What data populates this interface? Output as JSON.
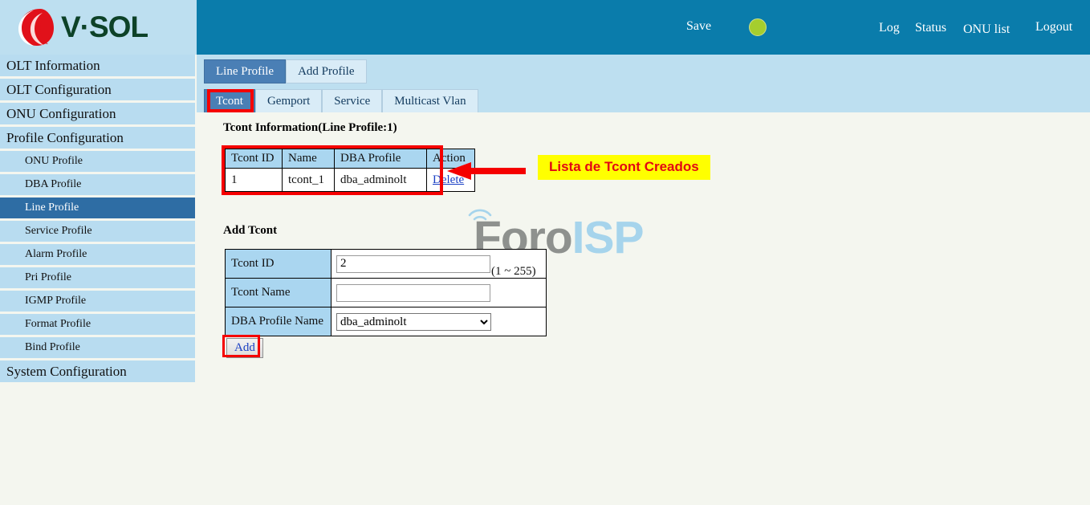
{
  "brand": {
    "name": "V·SOL",
    "logo_icon": "vsol-swirl-icon",
    "logo_color": "#e1111a",
    "text_color": "#0d4228"
  },
  "header": {
    "background": "#0a7cab",
    "save_label": "Save",
    "status_indicator": {
      "icon": "green-status-dot-icon",
      "color": "#a5ce2e"
    },
    "links": [
      {
        "label": "Log"
      },
      {
        "label": "Status"
      },
      {
        "label": "ONU list"
      },
      {
        "label": "Logout"
      }
    ]
  },
  "sidebar": {
    "items": [
      {
        "label": "OLT Information",
        "sub": false,
        "active": false
      },
      {
        "label": "OLT Configuration",
        "sub": false,
        "active": false
      },
      {
        "label": "ONU Configuration",
        "sub": false,
        "active": false
      },
      {
        "label": "Profile Configuration",
        "sub": false,
        "active": false
      },
      {
        "label": "ONU Profile",
        "sub": true,
        "active": false
      },
      {
        "label": "DBA Profile",
        "sub": true,
        "active": false
      },
      {
        "label": "Line Profile",
        "sub": true,
        "active": true
      },
      {
        "label": "Service Profile",
        "sub": true,
        "active": false
      },
      {
        "label": "Alarm Profile",
        "sub": true,
        "active": false
      },
      {
        "label": "Pri Profile",
        "sub": true,
        "active": false
      },
      {
        "label": "IGMP Profile",
        "sub": true,
        "active": false
      },
      {
        "label": "Format Profile",
        "sub": true,
        "active": false
      },
      {
        "label": "Bind Profile",
        "sub": true,
        "active": false
      },
      {
        "label": "System Configuration",
        "sub": false,
        "active": false
      }
    ]
  },
  "tabs_primary": [
    {
      "label": "Line Profile",
      "active": true
    },
    {
      "label": "Add Profile",
      "active": false
    }
  ],
  "tabs_secondary": [
    {
      "label": "Tcont",
      "active": true
    },
    {
      "label": "Gemport",
      "active": false
    },
    {
      "label": "Service",
      "active": false
    },
    {
      "label": "Multicast Vlan",
      "active": false
    }
  ],
  "main": {
    "info_title": "Tcont Information(Line Profile:1)",
    "info_table": {
      "headers": [
        "Tcont ID",
        "Name",
        "DBA Profile",
        "Action"
      ],
      "rows": [
        {
          "id": "1",
          "name": "tcont_1",
          "dba": "dba_adminolt",
          "action": "Delete"
        }
      ]
    },
    "add_title": "Add Tcont",
    "form": {
      "tcont_id_label": "Tcont ID",
      "tcont_id_value": "2",
      "tcont_id_hint": "(1 ~ 255)",
      "tcont_name_label": "Tcont Name",
      "tcont_name_value": "",
      "tcont_name_placeholder": "",
      "dba_label": "DBA Profile Name",
      "dba_selected": "dba_adminolt",
      "dba_options": [
        "dba_adminolt"
      ]
    },
    "add_button_label": "Add"
  },
  "annotation": {
    "label": "Lista de Tcont Creados",
    "box_color": "#ffff00",
    "text_color": "#e30613",
    "arrow_color": "#f50000",
    "highlight_color": "#f50000"
  },
  "watermark": {
    "part1": "Foro",
    "part2": "ISP",
    "part1_color": "#8e918e",
    "part2_color": "#a6d4ec"
  }
}
